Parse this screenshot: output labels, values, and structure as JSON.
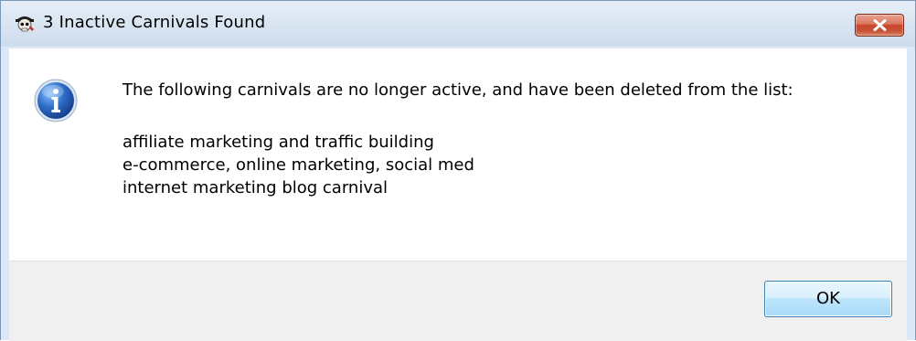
{
  "window": {
    "title": "3 Inactive Carnivals Found",
    "app_icon": "pirate-skull-icon",
    "close_icon": "close-x-icon"
  },
  "message": {
    "icon": "information-icon",
    "text": "The following carnivals are no longer active, and have been deleted from the list:",
    "items": [
      "affiliate marketing and traffic building",
      "e-commerce, online marketing, social med",
      "internet marketing blog carnival"
    ]
  },
  "buttons": {
    "ok_label": "OK"
  },
  "colors": {
    "close_button": "#c7462b",
    "ok_button": "#bee6fd",
    "info_icon": "#2f6fc8",
    "footer_background": "#f0f0f0"
  }
}
